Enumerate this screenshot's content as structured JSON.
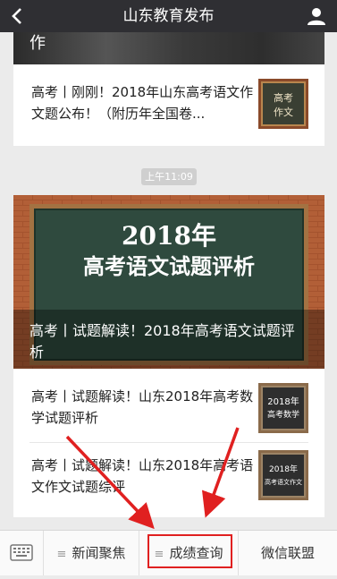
{
  "header": {
    "title": "山东教育发布",
    "back_icon": "chevron-left-icon",
    "profile_icon": "user-icon"
  },
  "article_top": {
    "photo_caption": "作",
    "item": {
      "title": "高考丨刚刚！2018年山东高考语文作文题公布！（附历年全国卷...",
      "thumb_text": [
        "高考",
        "作文"
      ]
    }
  },
  "timestamp": "上午11:09",
  "article_main": {
    "hero": {
      "board_year": "2018年",
      "board_line": "高考语文试题评析",
      "caption": "高考丨试题解读！2018年高考语文试题评析"
    },
    "items": [
      {
        "title": "高考丨试题解读！山东2018年高考数学试题评析",
        "thumb_lines": [
          "2018年",
          "高考数学"
        ]
      },
      {
        "title": "高考丨试题解读！山东2018年高考语文作文试题综评",
        "thumb_lines": [
          "2018年",
          "高考语文作文"
        ]
      }
    ]
  },
  "menu": {
    "keyboard_icon": "keyboard-icon",
    "items": [
      {
        "label": "新闻聚焦",
        "has_submenu": true
      },
      {
        "label": "成绩查询",
        "has_submenu": true,
        "highlighted": true
      },
      {
        "label": "微信联盟",
        "has_submenu": false
      }
    ]
  },
  "colors": {
    "header_bg": "#2f2f33",
    "highlight": "#e02020",
    "board_green": "#2f4a3e",
    "brick": "#a4532e"
  }
}
